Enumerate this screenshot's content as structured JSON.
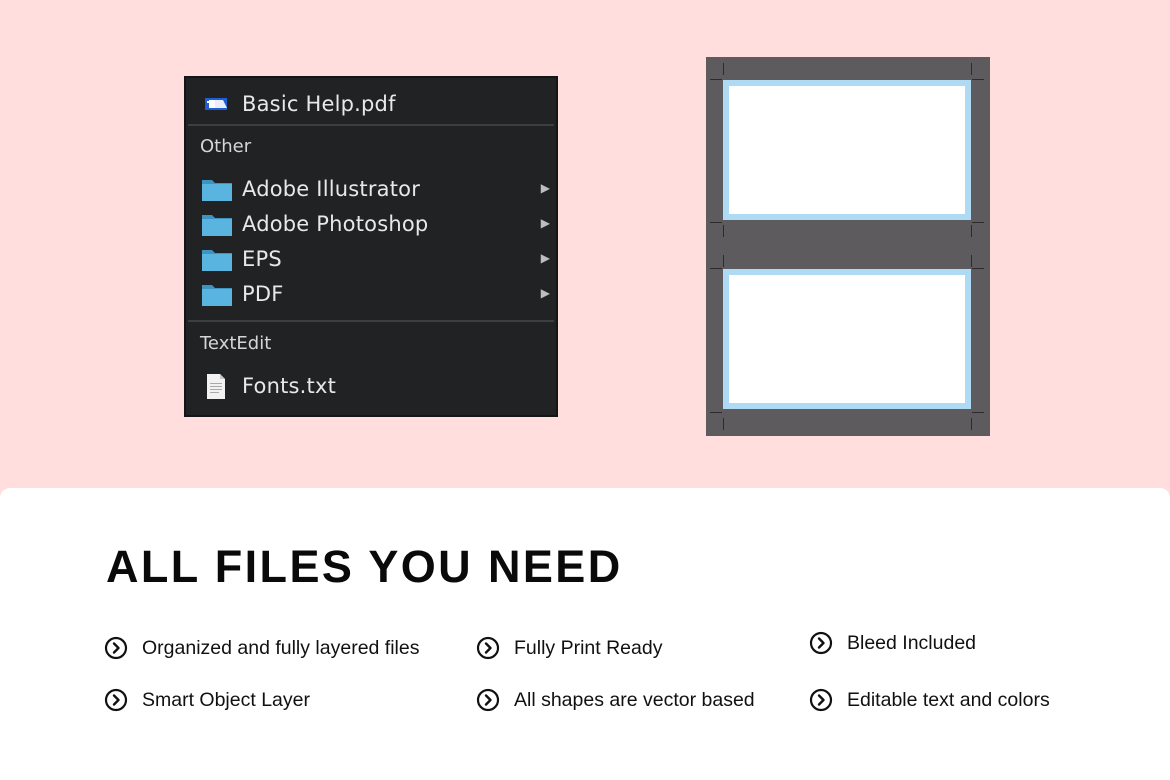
{
  "menu": {
    "pdf_item": "Basic Help.pdf",
    "section_other": "Other",
    "folders": [
      {
        "label": "Adobe Illustrator"
      },
      {
        "label": "Adobe Photoshop"
      },
      {
        "label": "EPS"
      },
      {
        "label": "PDF"
      }
    ],
    "section_textedit": "TextEdit",
    "txt_item": "Fonts.txt",
    "folder_color": "#5ab4e0",
    "background_color": "#212224"
  },
  "preview": {
    "cards": 2,
    "bleed_color": "#aedbf3",
    "background_color": "#5d5b5d"
  },
  "panel": {
    "headline": "ALL FILES YOU NEED",
    "features": [
      "Organized and fully layered files",
      "Fully Print Ready",
      "Bleed Included",
      "Smart Object Layer",
      "All shapes are vector based",
      "Editable text and colors"
    ],
    "bullet_icon": "chevron-right-circle-icon"
  },
  "colors": {
    "page_background": "#ffdedd",
    "panel_background": "#ffffff",
    "text": "#0a0a0a"
  }
}
